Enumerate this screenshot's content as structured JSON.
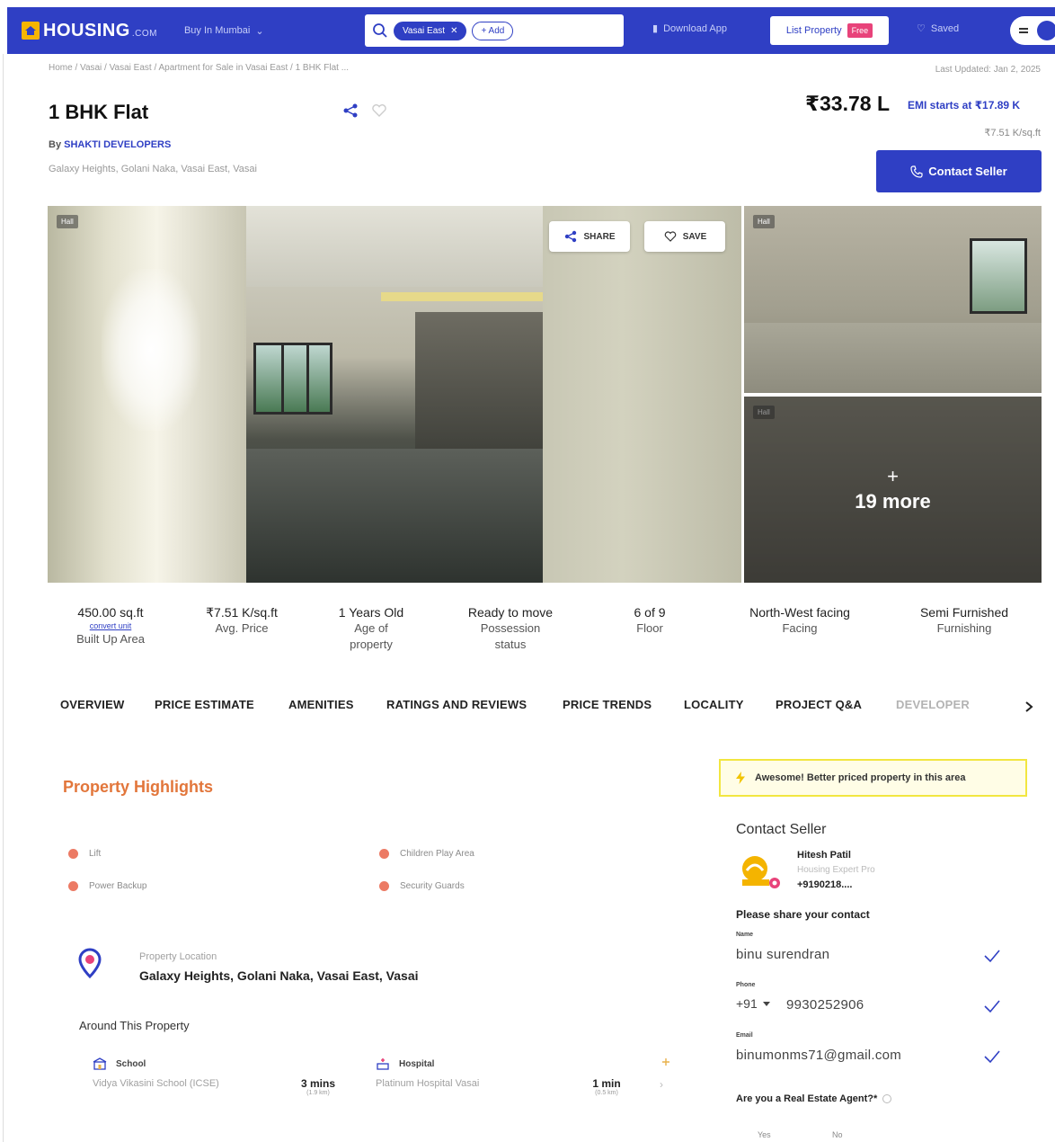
{
  "nav": {
    "logo": "HOUSING",
    "logo_suffix": ".COM",
    "city": "Buy In Mumbai",
    "search_chip": "Vasai East",
    "add_chip": "+ Add",
    "download": "Download App",
    "list_property": "List Property",
    "free": "Free",
    "saved": "Saved"
  },
  "header": {
    "breadcrumb": "Home / Vasai / Vasai East / Apartment for Sale in Vasai East / 1 BHK Flat ...",
    "last_updated": "Last Updated: Jan 2, 2025",
    "title": "1 BHK Flat",
    "price": "₹33.78 L",
    "emi": "EMI starts at ₹17.89 K",
    "price_per_sqft": "₹7.51 K/sq.ft",
    "by_prefix": "By ",
    "developer": "SHAKTI DEVELOPERS",
    "address": "Galaxy Heights, Golani Naka, Vasai East, Vasai",
    "contact_button": "Contact Seller"
  },
  "gallery": {
    "tag": "Hall",
    "share": "SHARE",
    "save": "SAVE",
    "more_plus": "+",
    "more": "19 more"
  },
  "stats": [
    {
      "value": "450.00 sq.ft",
      "link": "convert unit",
      "label": "Built Up Area"
    },
    {
      "value": "₹7.51 K/sq.ft",
      "label": "Avg. Price"
    },
    {
      "value": "1 Years Old",
      "label": "Age of property"
    },
    {
      "value": "Ready to move",
      "label": "Possession status"
    },
    {
      "value": "6 of 9",
      "label": "Floor"
    },
    {
      "value": "North-West facing",
      "label": "Facing"
    },
    {
      "value": "Semi Furnished",
      "label": "Furnishing"
    }
  ],
  "tabs": [
    "OVERVIEW",
    "PRICE ESTIMATE",
    "AMENITIES",
    "RATINGS AND REVIEWS",
    "PRICE TRENDS",
    "LOCALITY",
    "PROJECT Q&A",
    "DEVELOPER"
  ],
  "highlights": {
    "title": "Property Highlights",
    "amenities": [
      "Lift",
      "Children Play Area",
      "Power Backup",
      "Security Guards"
    ],
    "location_label": "Property Location",
    "location_value": "Galaxy Heights, Golani Naka, Vasai East, Vasai",
    "around_title": "Around This Property",
    "poi": [
      {
        "type": "School",
        "name": "Vidya Vikasini School (ICSE)",
        "time": "3 mins",
        "dist": "(1.9 km)"
      },
      {
        "type": "Hospital",
        "name": "Platinum Hospital Vasai",
        "time": "1 min",
        "dist": "(0.5 km)"
      }
    ]
  },
  "contact": {
    "banner": "Awesome! Better priced property in this area",
    "title": "Contact Seller",
    "seller_name": "Hitesh Patil",
    "seller_role": "Housing Expert Pro",
    "seller_phone": "+9190218....",
    "share_contact": "Please share your contact",
    "name_label": "Name",
    "name_value": "binu surendran",
    "phone_label": "Phone",
    "dial_code": "+91",
    "phone_value": "9930252906",
    "email_label": "Email",
    "email_value": "binumonms71@gmail.com",
    "agent_question": "Are you a Real Estate Agent?*",
    "yes": "Yes",
    "no": "No"
  },
  "colors": {
    "brand": "#2f3fc4",
    "accent_orange": "#e2763b",
    "amenity_dot": "#ec7a64",
    "banner_border": "#f2e640"
  }
}
